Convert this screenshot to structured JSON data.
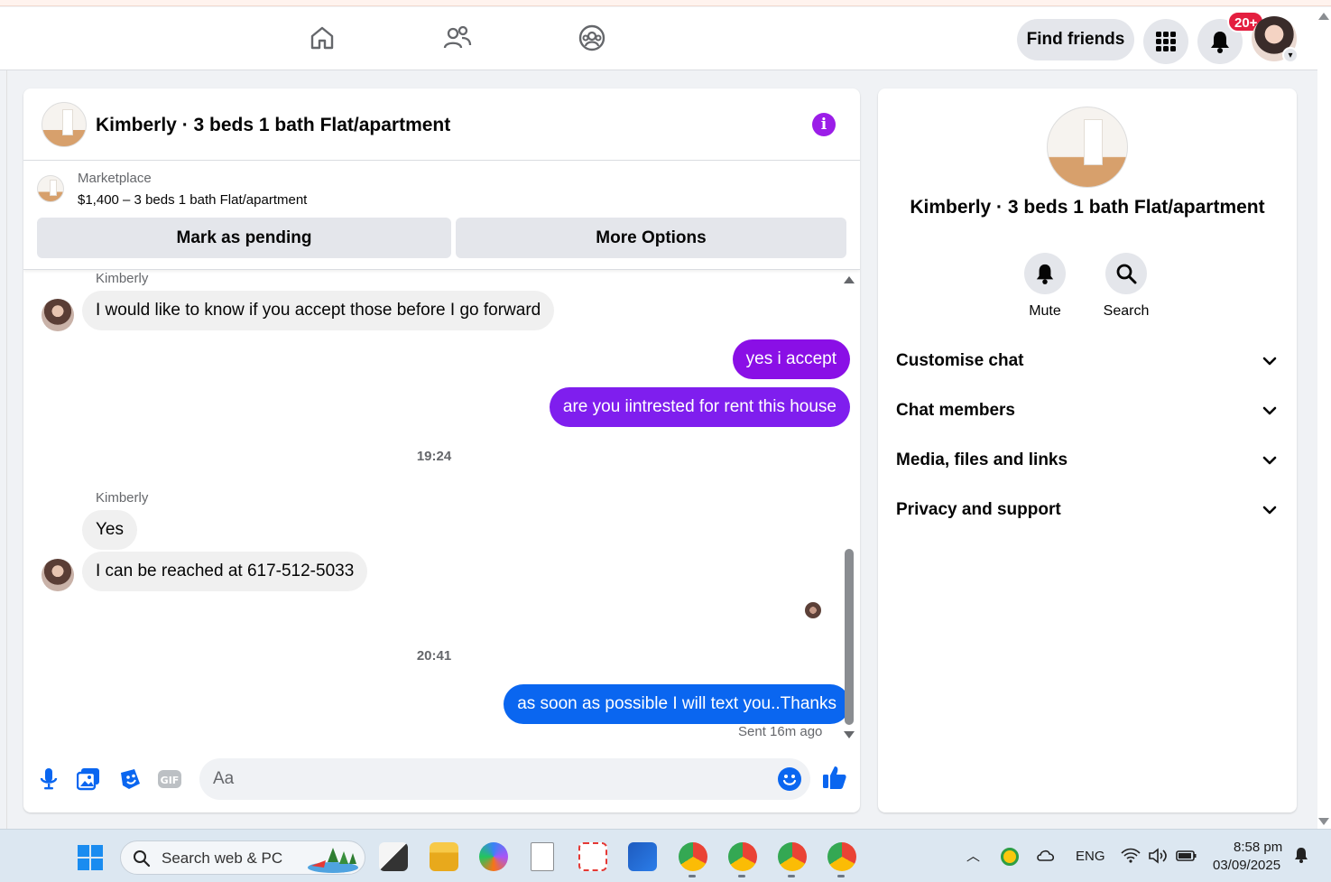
{
  "topbar": {
    "find_friends_label": "Find friends",
    "notification_count": "20+"
  },
  "chat": {
    "title": "Kimberly · 3 beds 1 bath Flat/apartment",
    "marketplace_label": "Marketplace",
    "listing": "$1,400 – 3 beds 1 bath Flat/apartment",
    "mark_pending_label": "Mark as pending",
    "more_options_label": "More Options",
    "messages": [
      {
        "sender": "Kimberly",
        "text": "I would like to know if you accept those before I go forward"
      },
      {
        "text": "yes i accept"
      },
      {
        "text": "are you iintrested for rent this house"
      },
      {
        "time": "19:24"
      },
      {
        "sender": "Kimberly",
        "text": "Yes"
      },
      {
        "text": "I can be reached at 617-512-5033"
      },
      {
        "time": "20:41"
      },
      {
        "text": "as soon as possible I will text you..Thanks"
      }
    ],
    "sent_status": "Sent 16m ago",
    "composer_placeholder": "Aa"
  },
  "right_panel": {
    "title": "Kimberly · 3 beds 1 bath Flat/apartment",
    "mute_label": "Mute",
    "search_label": "Search",
    "sections": [
      "Customise chat",
      "Chat members",
      "Media, files and links",
      "Privacy and support"
    ]
  },
  "taskbar": {
    "search_text": "Search web & PC",
    "language": "ENG",
    "time": "8:58 pm",
    "date": "03/09/2025"
  },
  "colors": {
    "accent_blue": "#0a66f0",
    "accent_purple": "#8a0fe6",
    "info_purple": "#9b1de8",
    "badge_red": "#e41e3f"
  }
}
